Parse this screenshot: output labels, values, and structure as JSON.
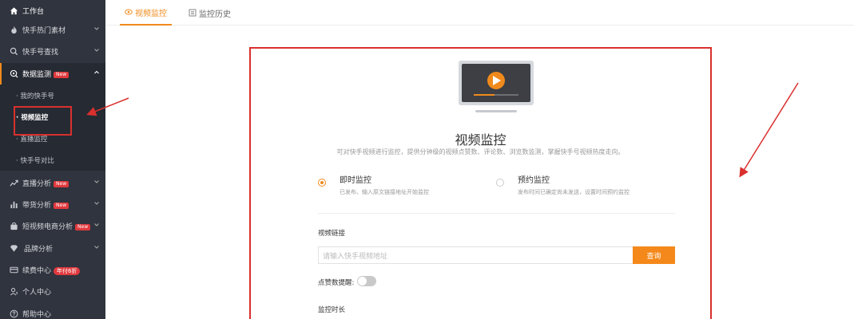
{
  "sidebar": {
    "items": [
      {
        "label": "工作台",
        "icon": "home-icon"
      },
      {
        "label": "快手热门素材",
        "icon": "fire-icon"
      },
      {
        "label": "快手号查找",
        "icon": "search-icon"
      },
      {
        "label": "数据监测",
        "icon": "monitor-search-icon",
        "badge": "New"
      },
      {
        "label": "直播分析",
        "icon": "trend-icon",
        "badge": "New"
      },
      {
        "label": "带货分析",
        "icon": "bar-chart-icon",
        "badge": "New"
      },
      {
        "label": "短视频电商分析",
        "icon": "bag-icon",
        "badge": "New"
      },
      {
        "label": "品牌分析",
        "icon": "diamond-icon"
      },
      {
        "label": "续费中心",
        "icon": "card-icon",
        "badge": "年付6折"
      },
      {
        "label": "个人中心",
        "icon": "user-icon"
      },
      {
        "label": "帮助中心",
        "icon": "help-icon"
      }
    ],
    "sub_items": [
      "· 我的快手号",
      "· 视频监控",
      "· 直播监控",
      "· 快手号对比"
    ]
  },
  "tabs": [
    {
      "label": "视频监控",
      "icon": "eye-icon"
    },
    {
      "label": "监控历史",
      "icon": "list-icon"
    }
  ],
  "card": {
    "title": "视频监控",
    "subtitle": "可对快手视频进行监控，提供分钟级的视频点赞数、评论数、浏览数监测，掌握快手号视频热度走向。",
    "options": [
      {
        "title": "即时监控",
        "desc": "已发布、输入原文链接地址开始监控",
        "checked": true
      },
      {
        "title": "预约监控",
        "desc": "发布时间已确定尚未发送，设置时间预约监控",
        "checked": false
      }
    ],
    "link_label": "视频链接",
    "link_placeholder": "请输入快手视频地址",
    "query_label": "查询",
    "like_alert_label": "点赞数提醒:",
    "duration_label": "监控时长"
  },
  "colors": {
    "accent": "#f08a1c",
    "sidebar_bg": "#30343e",
    "highlight_red": "#d9302e"
  }
}
